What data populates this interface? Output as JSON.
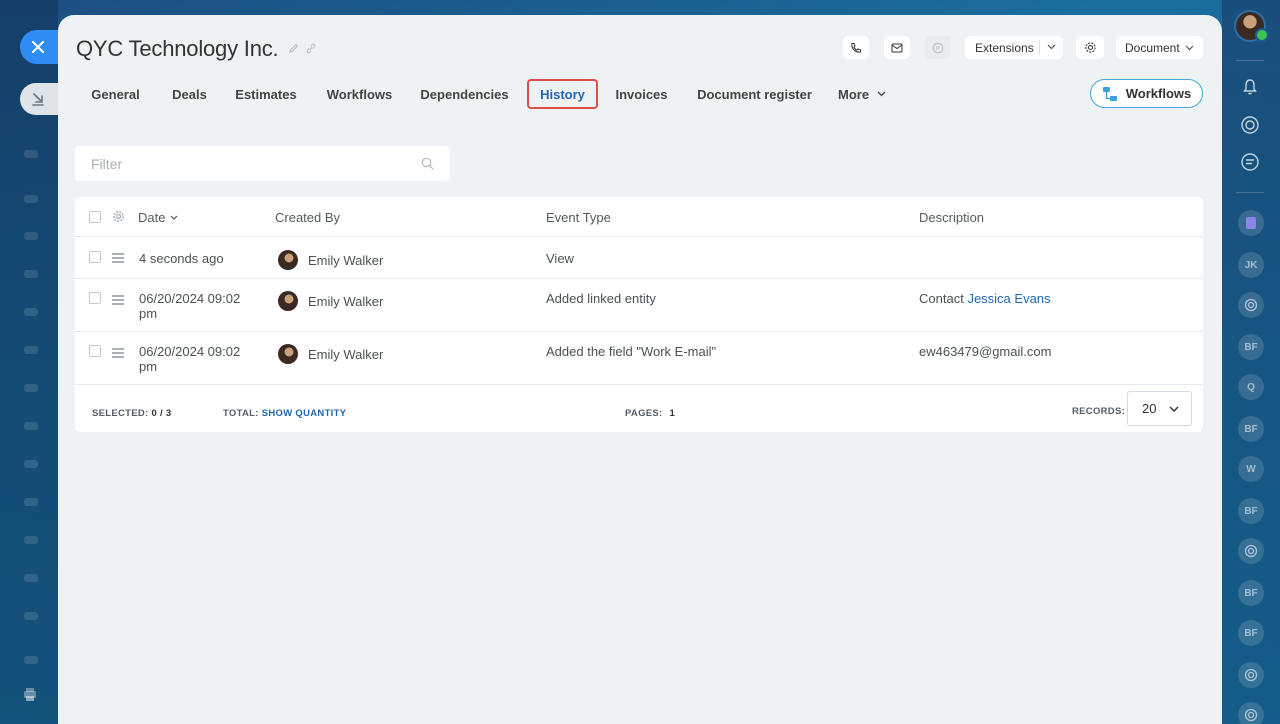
{
  "entity": {
    "title": "QYC Technology Inc."
  },
  "toolbar": {
    "extensions_label": "Extensions",
    "document_label": "Document"
  },
  "tabs": [
    {
      "label": "General"
    },
    {
      "label": "Deals"
    },
    {
      "label": "Estimates"
    },
    {
      "label": "Workflows"
    },
    {
      "label": "Dependencies"
    },
    {
      "label": "History",
      "active": true
    },
    {
      "label": "Invoices"
    },
    {
      "label": "Document register"
    },
    {
      "label": "More"
    }
  ],
  "workflows_button": {
    "label": "Workflows"
  },
  "filter": {
    "placeholder": "Filter",
    "value": ""
  },
  "grid": {
    "columns": [
      "Date",
      "Created By",
      "Event Type",
      "Description"
    ],
    "rows": [
      {
        "date_line1": "4 seconds ago",
        "date_line2": "",
        "created_by": "Emily Walker",
        "event_type": "View",
        "description_text": "",
        "description_link": ""
      },
      {
        "date_line1": "06/20/2024 09:02",
        "date_line2": "pm",
        "created_by": "Emily Walker",
        "event_type": "Added linked entity",
        "description_text": "Contact",
        "description_link": "Jessica Evans"
      },
      {
        "date_line1": "06/20/2024 09:02",
        "date_line2": "pm",
        "created_by": "Emily Walker",
        "event_type": "Added the field \"Work E-mail\"",
        "description_text": "ew463479@gmail.com",
        "description_link": ""
      }
    ],
    "footer": {
      "selected_label": "SELECTED:",
      "selected_value": "0 / 3",
      "total_label": "TOTAL:",
      "total_link": "SHOW QUANTITY",
      "pages_label": "PAGES:",
      "pages_value": "1",
      "records_label": "RECORDS:",
      "records_value": "20"
    }
  },
  "right_rail": {
    "avatars": [
      "JK",
      "BF",
      "Q",
      "BF",
      "W",
      "BF",
      "BF",
      "BF"
    ]
  },
  "colors": {
    "accent": "#2067b0",
    "highlight_border": "#e0504a",
    "close_button": "#2f8df5",
    "online": "#3cc254"
  }
}
